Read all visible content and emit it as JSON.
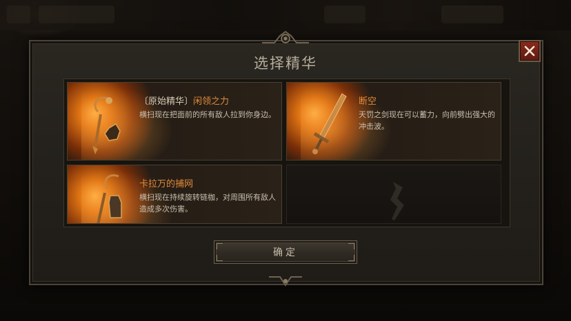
{
  "dialog": {
    "title": "选择精华",
    "close_glyph": "✕",
    "confirm_label": "确定"
  },
  "essences": [
    {
      "prefix": "〔原始精华〕",
      "name": "闲领之力",
      "description": "横扫现在把面前的所有敌人拉到你身边。",
      "icon": "flail-icon"
    },
    {
      "prefix": "",
      "name": "断空",
      "description": "天罚之剑现在可以蓄力，向前劈出强大的冲击波。",
      "icon": "sword-icon"
    },
    {
      "prefix": "",
      "name": "卡拉万的捕网",
      "description": "横扫现在持续旋转链枷，对周围所有敌人造成多次伤害。",
      "icon": "chain-flail-icon"
    }
  ],
  "colors": {
    "name_orange": "#e08a3a",
    "text_light": "#c9bfae",
    "close_red": "#8a2a1c"
  }
}
